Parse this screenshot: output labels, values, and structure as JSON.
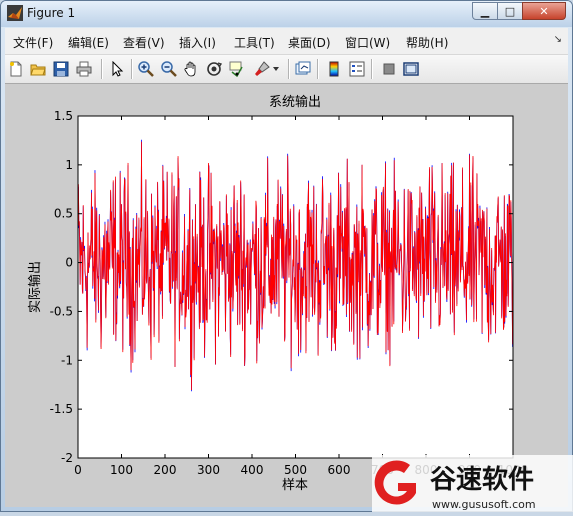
{
  "window": {
    "title": "Figure 1"
  },
  "menu": [
    "文件(F)",
    "编辑(E)",
    "查看(V)",
    "插入(I)",
    "工具(T)",
    "桌面(D)",
    "窗口(W)",
    "帮助(H)"
  ],
  "toolbar": {
    "icons": [
      "new-figure-icon",
      "open-file-icon",
      "save-icon",
      "print-icon",
      "edit-plot-arrow-icon",
      "zoom-in-icon",
      "zoom-out-icon",
      "pan-hand-icon",
      "rotate-3d-icon",
      "data-cursor-icon",
      "brush-icon",
      "brush-dropdown-icon",
      "link-plot-icon",
      "colorbar-icon",
      "legend-icon",
      "hide-plot-tools-icon",
      "show-plot-tools-icon"
    ]
  },
  "chart_data": {
    "type": "line",
    "title": "系统输出",
    "xlabel": "样本",
    "ylabel": "实际输出",
    "xlim": [
      0,
      1000
    ],
    "ylim": [
      -2,
      1.5
    ],
    "xticks": [
      0,
      100,
      200,
      300,
      400,
      500,
      600,
      700,
      800,
      900,
      1000
    ],
    "yticks": [
      -2,
      -1.5,
      -1,
      -0.5,
      0,
      0.5,
      1,
      1.5
    ],
    "series": [
      {
        "color": "#0000ff",
        "style": "random signal, approx range -1.5 to 1.45"
      },
      {
        "color": "#ff0000",
        "style": "random signal overlay, nearly identical to blue"
      }
    ],
    "grid": false,
    "legend": "none"
  },
  "watermark": {
    "brand": "谷速软件",
    "url": "www.gususoft.com",
    "logo_color": "#e02020"
  }
}
